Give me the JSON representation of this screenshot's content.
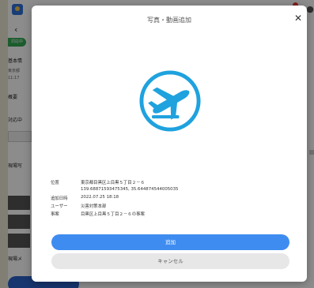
{
  "dialog": {
    "title": "写真・動画追加",
    "close_glyph": "✕",
    "hero_icon": "airplane-takeoff-icon",
    "accent_color": "#1fa2de",
    "info": [
      {
        "key": "位置",
        "value": "東京都目黒区上目黒５丁目２－６"
      },
      {
        "key": "",
        "value": "139.68871593475345, 35.644874544005035"
      },
      {
        "key": "追加日時",
        "value": "2022.07.25 18:18"
      },
      {
        "key": "ユーザー",
        "value": "災害対策本部"
      },
      {
        "key": "事案",
        "value": "目黒区上目黒５丁目２－６の事案"
      }
    ],
    "primary_button": "追加",
    "secondary_button": "キャンセル",
    "primary_color": "#3f8cf0"
  },
  "background": {
    "status_badge": "対応中",
    "section_basic": "基本情",
    "address_snippet": "東京都",
    "time_snippet": "11:17",
    "section_summary": "概要",
    "section_response": "対応中",
    "section_site": "現場写",
    "section_site2": "現場メ"
  }
}
